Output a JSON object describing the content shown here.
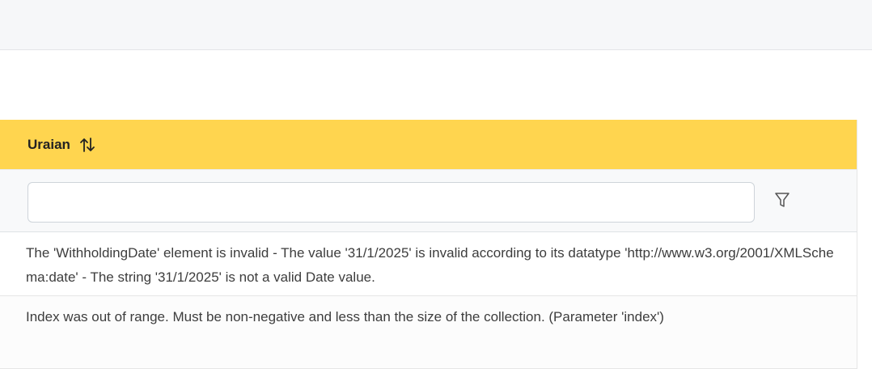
{
  "table": {
    "column_header": "Uraian",
    "filter": {
      "value": "",
      "placeholder": ""
    },
    "rows": [
      "The 'WithholdingDate' element is invalid - The value '31/1/2025' is invalid according to its datatype 'http://www.w3.org/2001/XMLSchema:date' - The string '31/1/2025' is not a valid Date value.",
      "Index was out of range. Must be non-negative and less than the size of the collection. (Parameter 'index')"
    ]
  },
  "icons": {
    "sort": "sort-icon",
    "filter": "filter-icon"
  },
  "colors": {
    "header_bg": "#ffd54f",
    "topbar_bg": "#f6f7f9",
    "filter_row_bg": "#f8f9fa"
  }
}
